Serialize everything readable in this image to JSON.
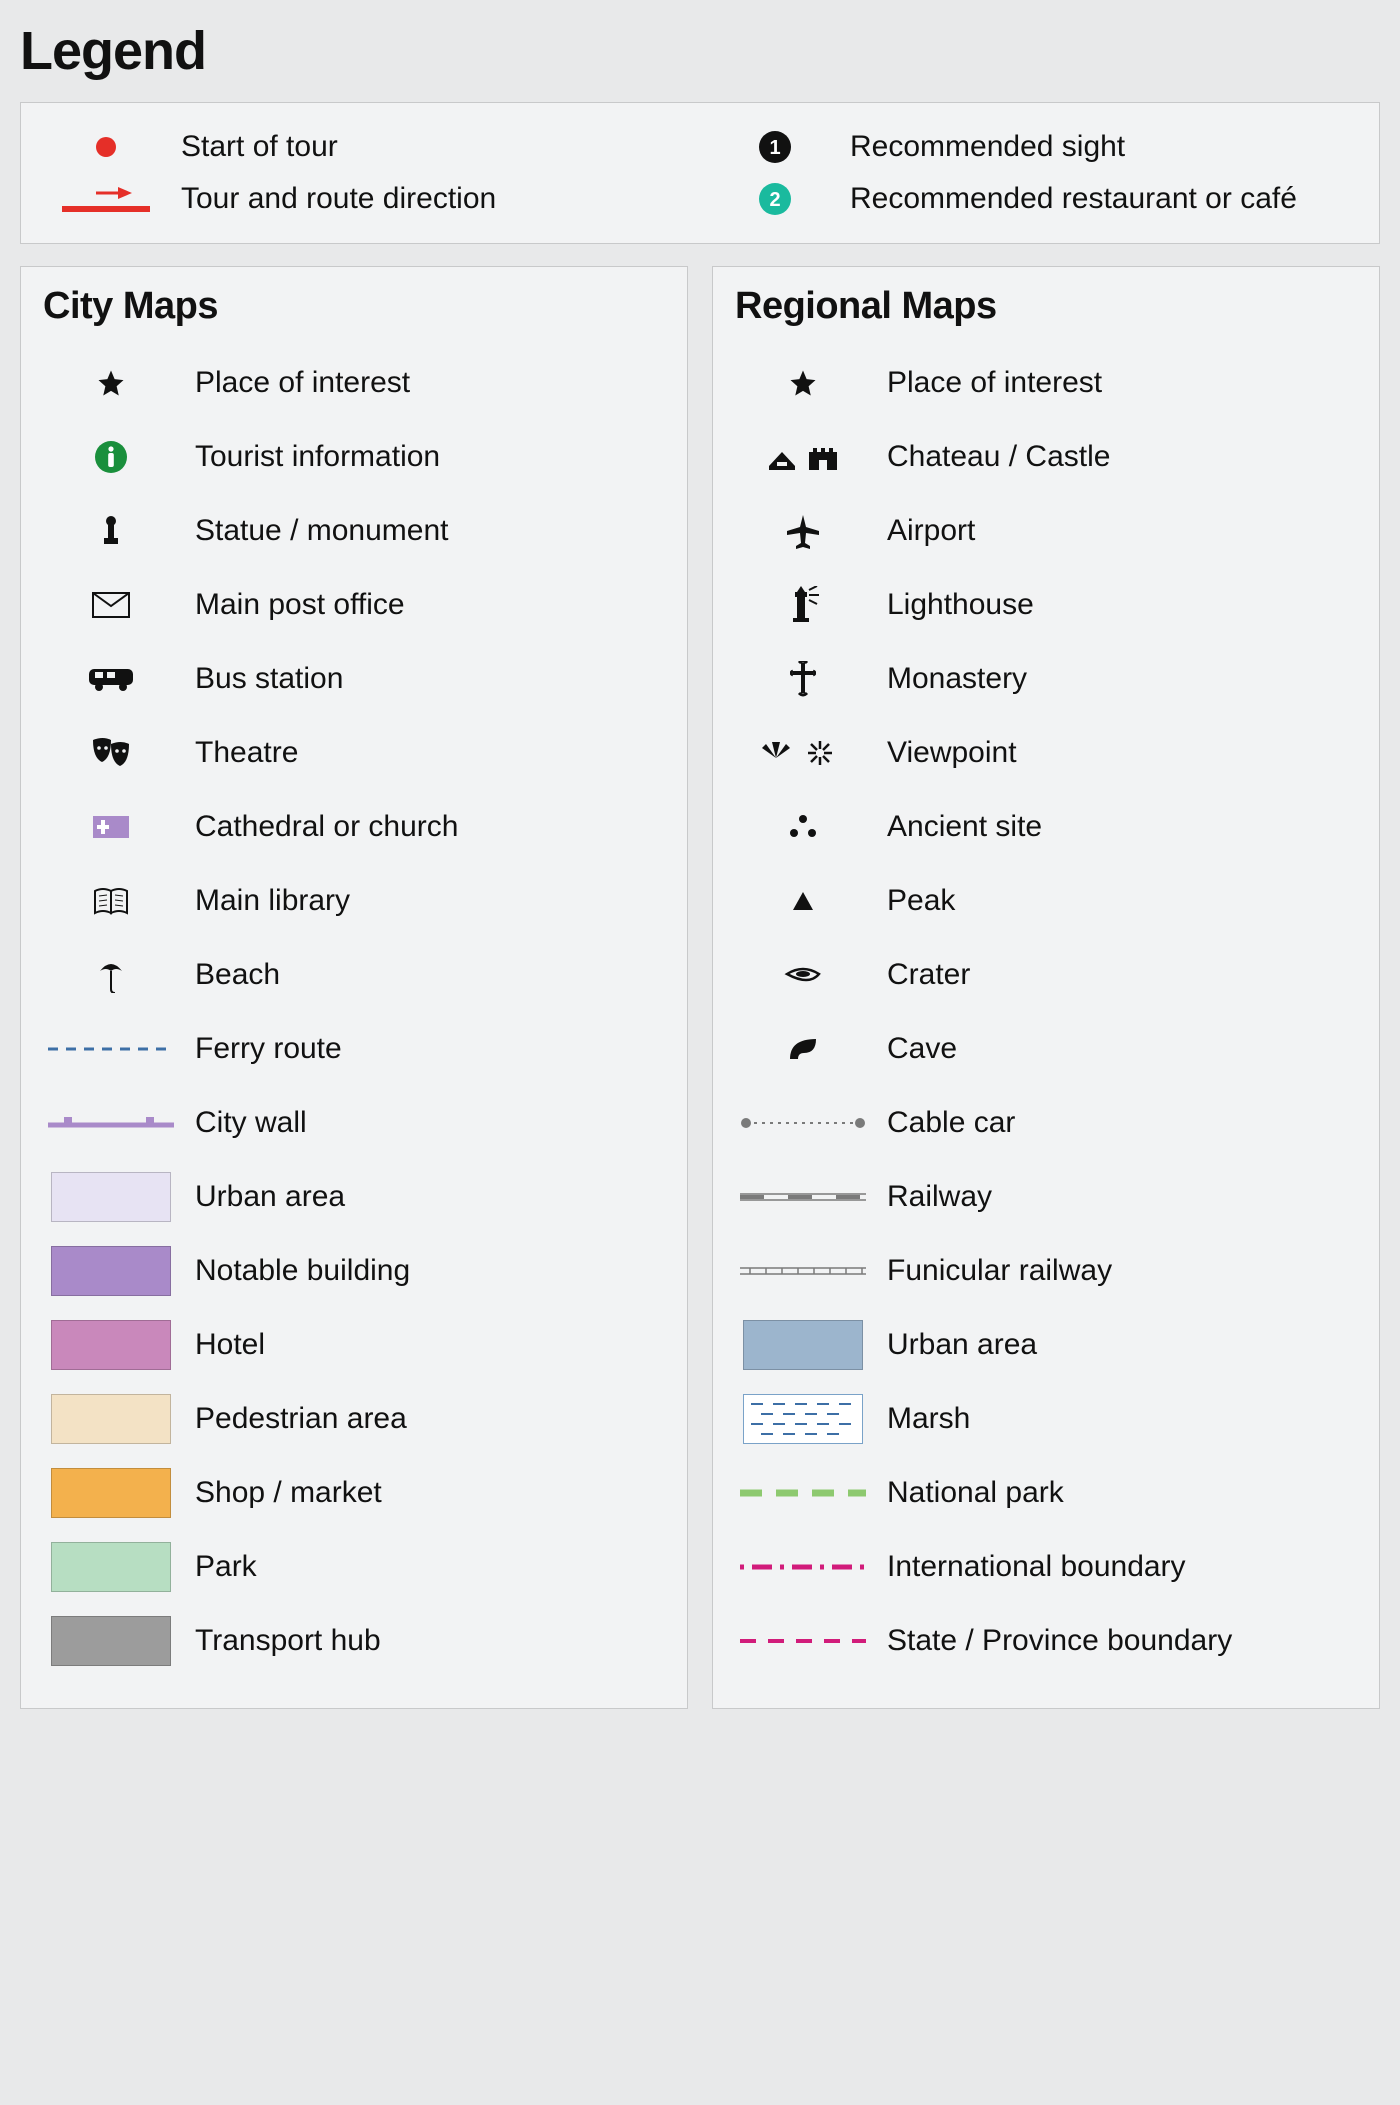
{
  "title": "Legend",
  "top": [
    {
      "id": "start",
      "label": "Start of tour"
    },
    {
      "id": "sight",
      "label": "Recommended sight"
    },
    {
      "id": "route",
      "label": "Tour and route direction"
    },
    {
      "id": "restaurant",
      "label": "Recommended restaurant or café"
    }
  ],
  "city": {
    "heading": "City Maps",
    "items": [
      {
        "id": "poi",
        "label": "Place of interest"
      },
      {
        "id": "tourist",
        "label": "Tourist information"
      },
      {
        "id": "statue",
        "label": "Statue / monument"
      },
      {
        "id": "post",
        "label": "Main post office"
      },
      {
        "id": "bus",
        "label": "Bus station"
      },
      {
        "id": "theatre",
        "label": "Theatre"
      },
      {
        "id": "church",
        "label": "Cathedral or church"
      },
      {
        "id": "library",
        "label": "Main library"
      },
      {
        "id": "beach",
        "label": "Beach"
      },
      {
        "id": "ferry",
        "label": "Ferry route"
      },
      {
        "id": "wall",
        "label": "City wall"
      },
      {
        "id": "urban",
        "label": "Urban area"
      },
      {
        "id": "notable",
        "label": "Notable building"
      },
      {
        "id": "hotel",
        "label": "Hotel"
      },
      {
        "id": "pedestrian",
        "label": "Pedestrian area"
      },
      {
        "id": "shop",
        "label": "Shop / market"
      },
      {
        "id": "park",
        "label": "Park"
      },
      {
        "id": "transport",
        "label": "Transport hub"
      }
    ]
  },
  "regional": {
    "heading": "Regional Maps",
    "items": [
      {
        "id": "poi",
        "label": "Place of interest"
      },
      {
        "id": "castle",
        "label": "Chateau / Castle"
      },
      {
        "id": "airport",
        "label": "Airport"
      },
      {
        "id": "lighthouse",
        "label": "Lighthouse"
      },
      {
        "id": "monastery",
        "label": "Monastery"
      },
      {
        "id": "viewpoint",
        "label": "Viewpoint"
      },
      {
        "id": "ancient",
        "label": "Ancient site"
      },
      {
        "id": "peak",
        "label": "Peak"
      },
      {
        "id": "crater",
        "label": "Crater"
      },
      {
        "id": "cave",
        "label": "Cave"
      },
      {
        "id": "cablecar",
        "label": "Cable car"
      },
      {
        "id": "railway",
        "label": "Railway"
      },
      {
        "id": "funicular",
        "label": "Funicular railway"
      },
      {
        "id": "urban",
        "label": "Urban area"
      },
      {
        "id": "marsh",
        "label": "Marsh"
      },
      {
        "id": "natpark",
        "label": "National park"
      },
      {
        "id": "intl",
        "label": "International boundary"
      },
      {
        "id": "state",
        "label": "State / Province boundary"
      }
    ]
  }
}
